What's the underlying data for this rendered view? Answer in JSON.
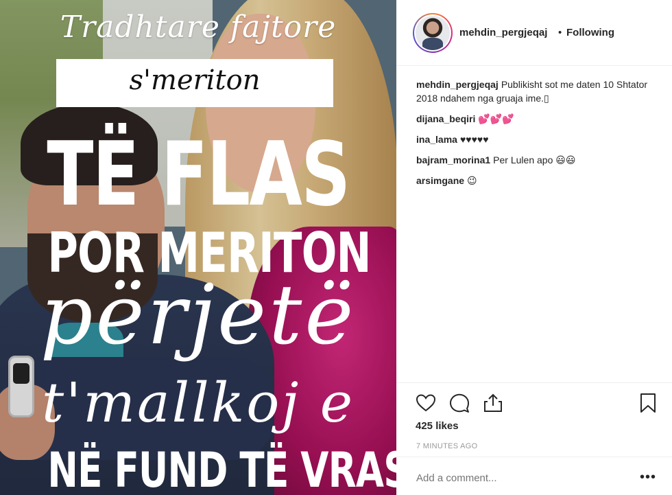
{
  "post_image": {
    "line1": "Tradhtare fajtore",
    "line2": "s'meriton",
    "line3": "TË FLAS",
    "line4": "POR MERITON",
    "line5": "përjetë",
    "line6": "t'mallkoj e",
    "line7": "NË FUND TË VRAS"
  },
  "header": {
    "username": "mehdin_pergjeqaj",
    "separator": "•",
    "follow_status": "Following"
  },
  "comments": [
    {
      "user": "mehdin_pergjeqaj",
      "text": "Publikisht sot me daten 10 Shtator 2018 ndahem nga gruaja ime.▯"
    },
    {
      "user": "dijana_beqiri",
      "text": "💕💕💕"
    },
    {
      "user": "ina_lama",
      "text": "♥♥♥♥♥"
    },
    {
      "user": "bajram_morina1",
      "text": "Per Lulen apo 😃😃"
    },
    {
      "user": "arsimgane",
      "text": "😉"
    }
  ],
  "actions": {
    "likes": "425 likes",
    "timestamp": "7 MINUTES AGO",
    "icons": [
      "heart-icon",
      "comment-icon",
      "share-icon",
      "bookmark-icon"
    ]
  },
  "add_comment": {
    "placeholder": "Add a comment...",
    "more_label": "•••"
  }
}
